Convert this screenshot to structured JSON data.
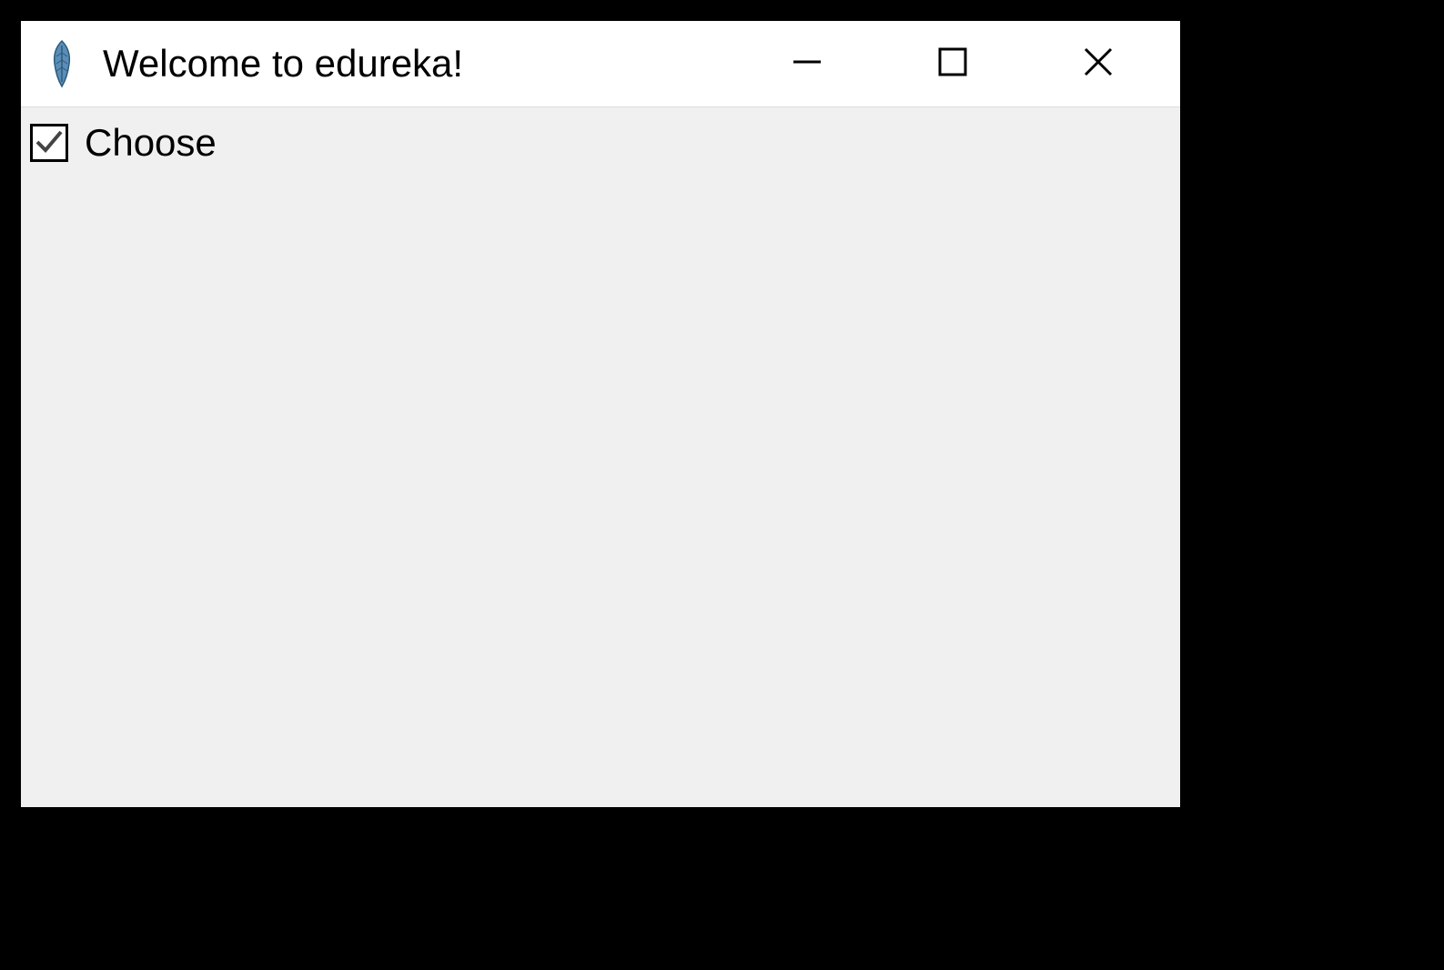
{
  "window": {
    "title": "Welcome to edureka!"
  },
  "content": {
    "checkbutton": {
      "label": "Choose",
      "checked": true
    }
  }
}
